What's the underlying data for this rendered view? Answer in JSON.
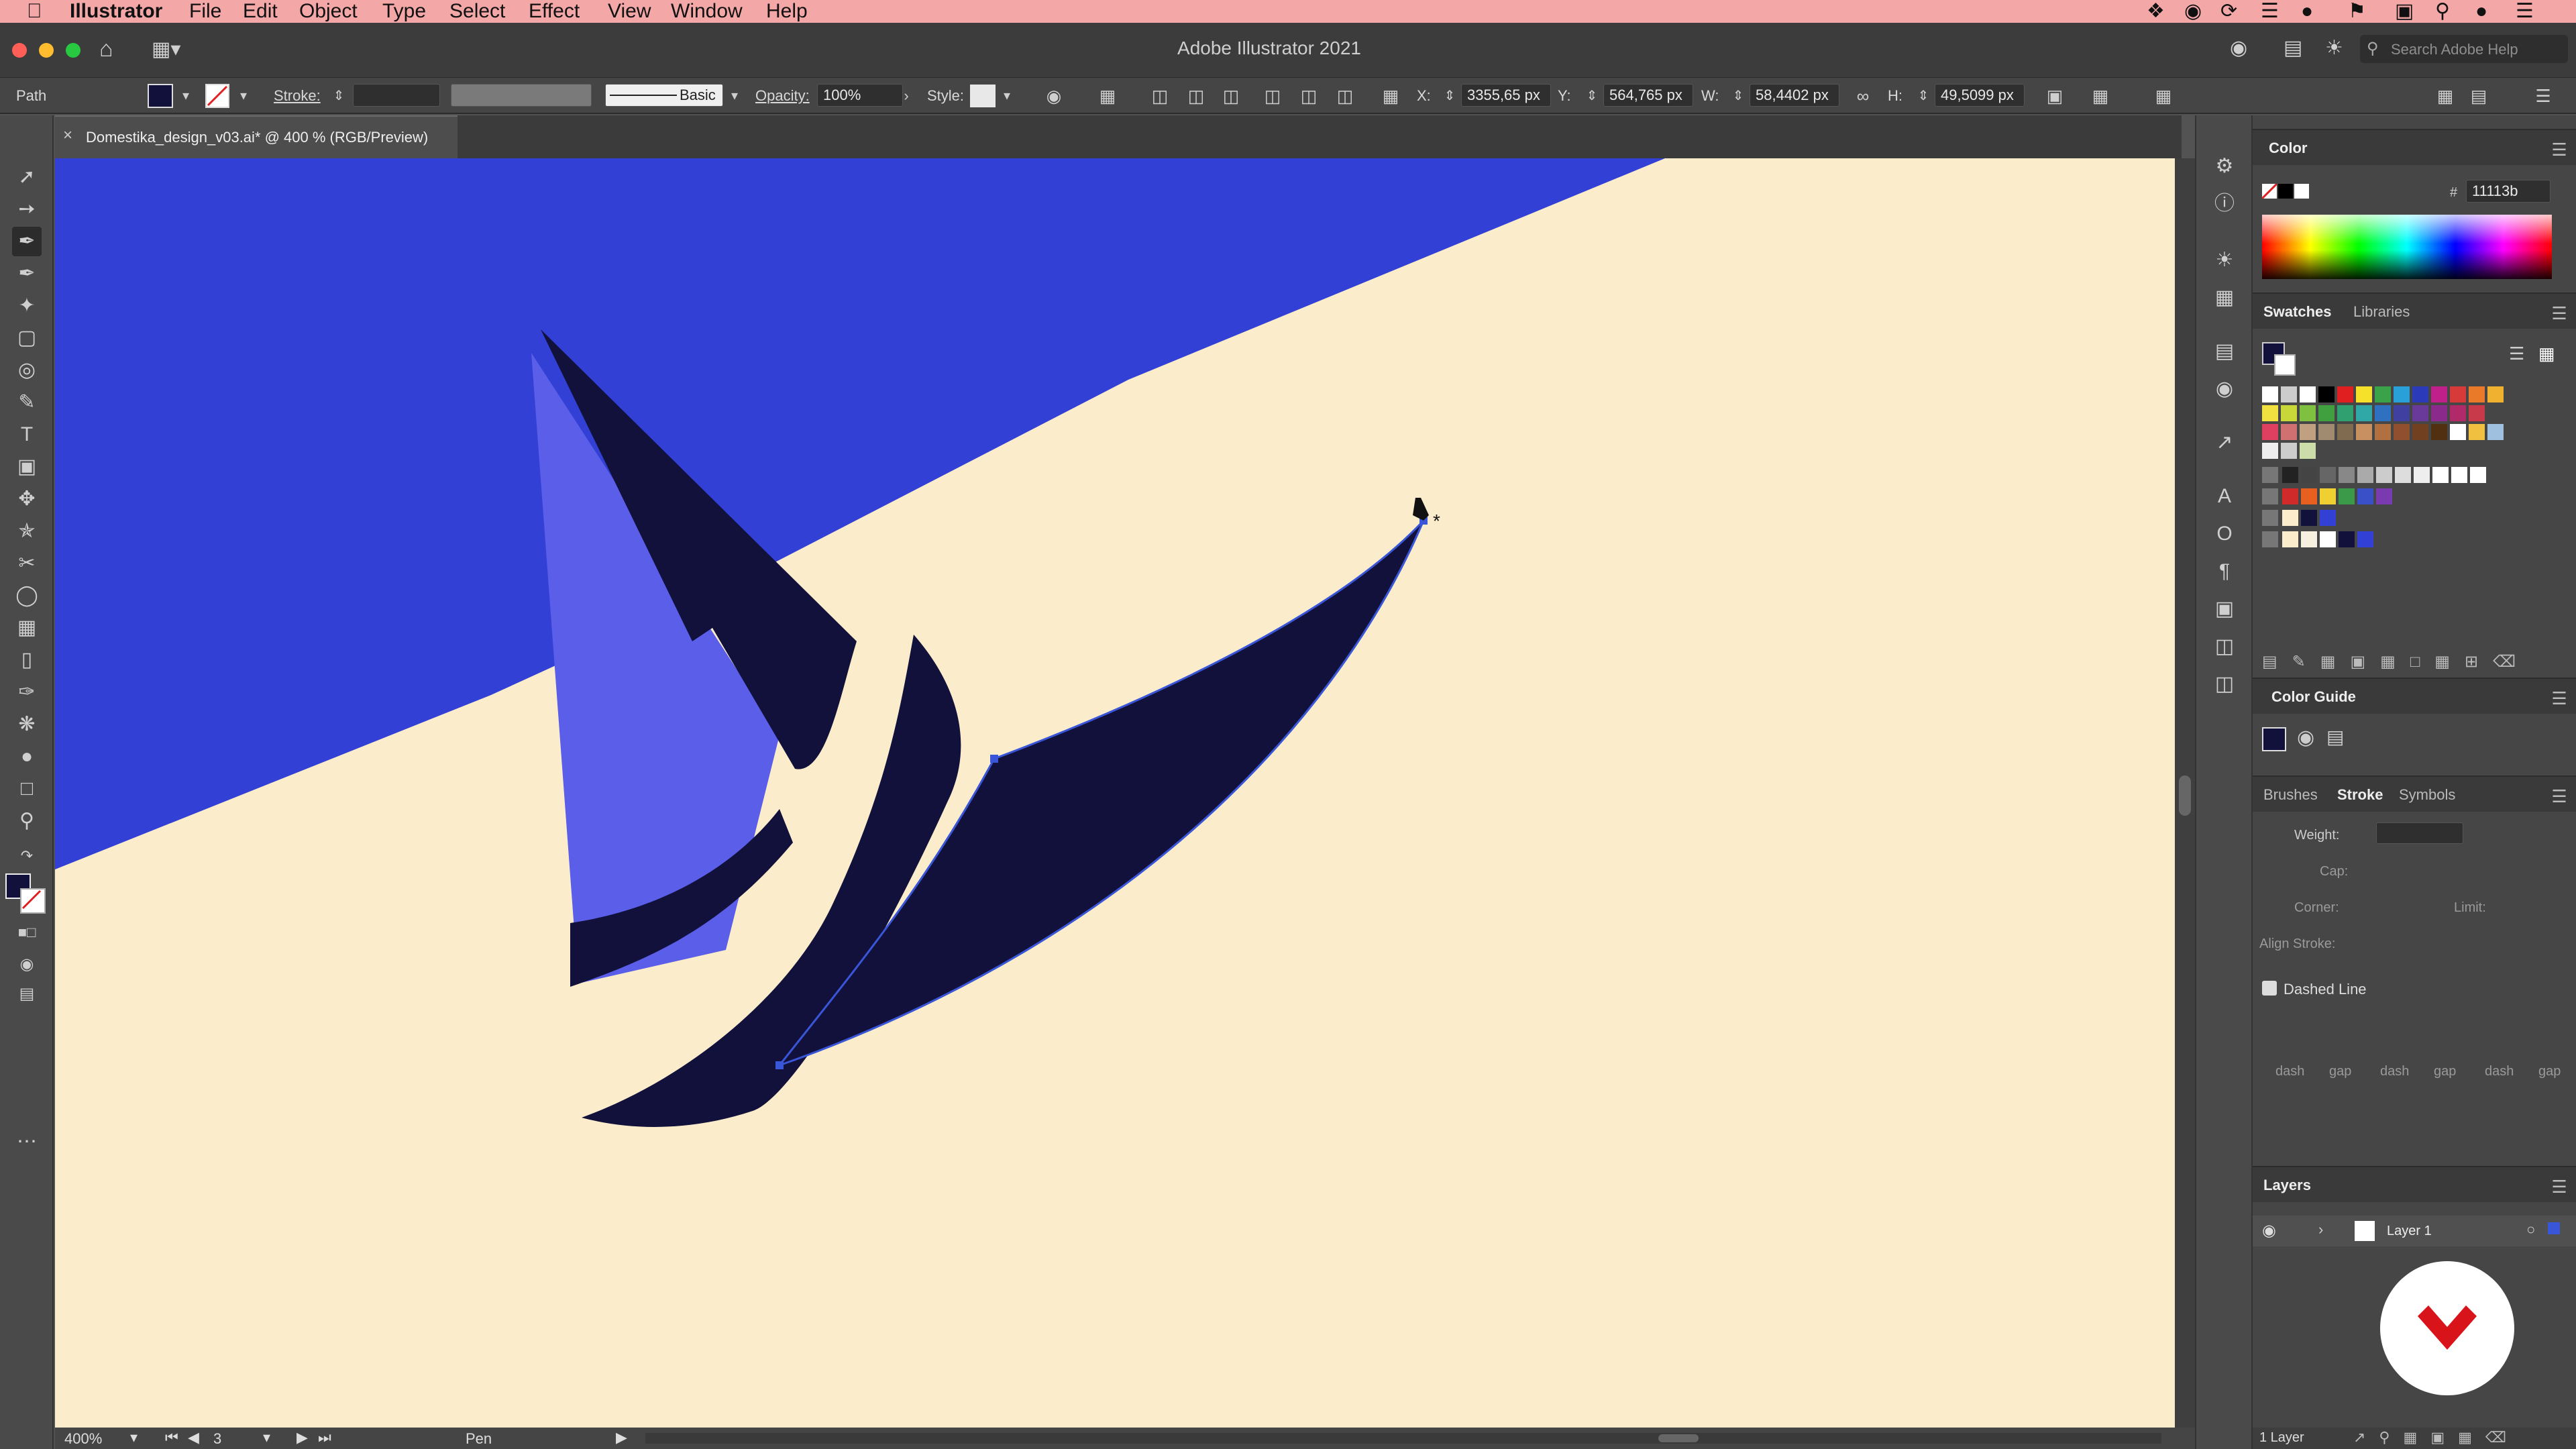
{
  "menubar": {
    "app": "Illustrator",
    "items": [
      "File",
      "Edit",
      "Object",
      "Type",
      "Select",
      "Effect",
      "View",
      "Window",
      "Help"
    ]
  },
  "window": {
    "title": "Adobe Illustrator 2021"
  },
  "search": {
    "placeholder": "Search Adobe Help"
  },
  "controlbar": {
    "selection_type": "Path",
    "stroke_label": "Stroke:",
    "brush": "Basic",
    "opacity_label": "Opacity:",
    "opacity_value": "100%",
    "style_label": "Style:",
    "x_label": "X:",
    "x_value": "3355,65 px",
    "y_label": "Y:",
    "y_value": "564,765 px",
    "w_label": "W:",
    "w_value": "58,4402 px",
    "h_label": "H:",
    "h_value": "49,5099 px"
  },
  "document": {
    "tab_title": "Domestika_design_v03.ai* @ 400 % (RGB/Preview)"
  },
  "statusbar": {
    "zoom": "400%",
    "artboard": "3",
    "tool": "Pen"
  },
  "color_panel": {
    "title": "Color",
    "hex_label": "#",
    "hex": "11113b"
  },
  "swatches_panel": {
    "tabs": [
      "Swatches",
      "Libraries"
    ]
  },
  "color_guide": {
    "title": "Color Guide"
  },
  "stroke_panel": {
    "tabs": [
      "Brushes",
      "Stroke",
      "Symbols"
    ],
    "weight_label": "Weight:",
    "cap_label": "Cap:",
    "corner_label": "Corner:",
    "limit_label": "Limit:",
    "align_label": "Align Stroke:",
    "dashed_label": "Dashed Line",
    "dash_labels": [
      "dash",
      "gap",
      "dash",
      "gap",
      "dash",
      "gap"
    ]
  },
  "layers_panel": {
    "title": "Layers",
    "layer_name": "Layer 1",
    "count": "1 Layer"
  },
  "colors": {
    "menubar": "#f4a7a7",
    "canvas": "#fbedcc",
    "blue": "#3240d6",
    "navy": "#11113b",
    "lilac": "#5a5ee8",
    "accent_red": "#d9131a"
  }
}
